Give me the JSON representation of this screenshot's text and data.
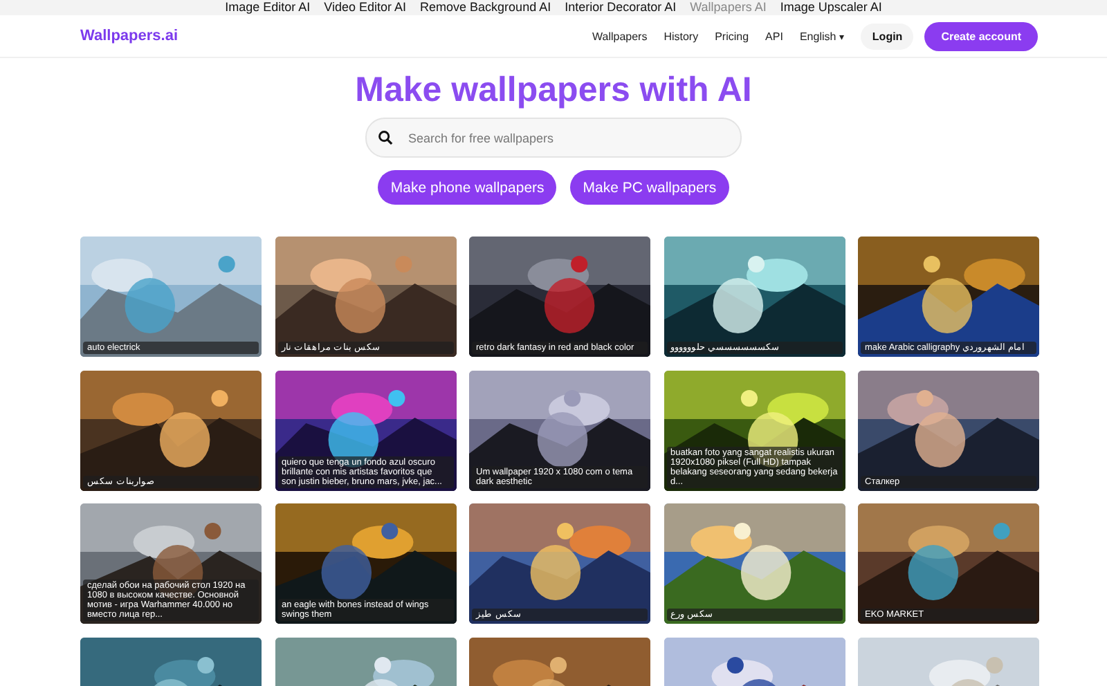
{
  "top_links": [
    {
      "label": "Image Editor AI",
      "selected": false
    },
    {
      "label": "Video Editor AI",
      "selected": false
    },
    {
      "label": "Remove Background AI",
      "selected": false
    },
    {
      "label": "Interior Decorator AI",
      "selected": false
    },
    {
      "label": "Wallpapers AI",
      "selected": true
    },
    {
      "label": "Image Upscaler AI",
      "selected": false
    }
  ],
  "logo": "Wallpapers.ai",
  "nav": [
    "Wallpapers",
    "History",
    "Pricing",
    "API"
  ],
  "language": {
    "label": "English",
    "caret": "▾"
  },
  "login": "Login",
  "create_account": "Create account",
  "heading": "Make wallpapers with AI",
  "search": {
    "placeholder": "Search for free wallpapers"
  },
  "actions": [
    "Make phone wallpapers",
    "Make PC wallpapers"
  ],
  "wallpapers": [
    {
      "caption": "auto electrick"
    },
    {
      "caption": "سكس بنات مراهقات نار"
    },
    {
      "caption": "retro dark fantasy in red and black color"
    },
    {
      "caption": "سكسسسسسسي حلوووووو"
    },
    {
      "caption": "make Arabic calligraphy امام الشهروردي"
    },
    {
      "caption": "صواربنات سكس"
    },
    {
      "caption": "quiero que tenga un fondo azul oscuro brillante con mis artistas favoritos que son justin bieber, bruno mars, jvke, jac..."
    },
    {
      "caption": "Um wallpaper 1920 x 1080 com o tema dark aesthetic"
    },
    {
      "caption": "buatkan foto yang sangat realistis ukuran 1920x1080 piksel (Full HD) tampak belakang seseorang yang sedang bekerja d..."
    },
    {
      "caption": "Сталкер"
    },
    {
      "caption": "сделай обои на рабочий стол 1920 на 1080 в высоком качестве. Основной мотив - игра Warhammer 40.000 но вместо лица гер..."
    },
    {
      "caption": "an eagle with bones instead of wings swings them"
    },
    {
      "caption": "سكس طيز"
    },
    {
      "caption": "سكس ورع"
    },
    {
      "caption": "EKO MARKET"
    },
    {
      "kind": "picture"
    },
    {
      "kind": "picture"
    },
    {
      "kind": "picture"
    },
    {
      "kind": "picture"
    },
    {
      "kind": "picture"
    }
  ]
}
